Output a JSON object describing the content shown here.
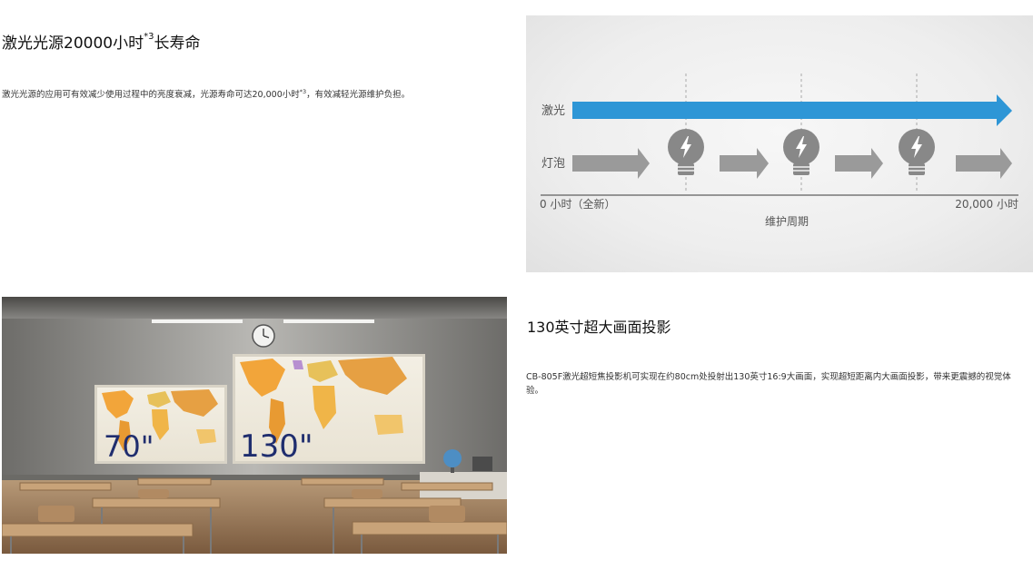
{
  "laser_section": {
    "heading_main": "激光光源20000小时",
    "heading_sup": "*3",
    "heading_tail": "长寿命",
    "desc_main": "激光光源的应用可有效减少使用过程中的亮度衰减，光源寿命可达20,000小时",
    "desc_sup": "*3",
    "desc_tail": "，有效减轻光源维护负担。"
  },
  "timeline_diagram": {
    "row_laser_label": "激光",
    "row_bulb_label": "灯泡",
    "start_label": "0 小时（全新）",
    "end_label": "20,000 小时",
    "axis_caption": "维护周期",
    "colors": {
      "laser_arrow": "#2e96d6",
      "bulb_arrow": "#9a9a9a",
      "bulb_icon": "#888888"
    },
    "icons": [
      "lightbulb-icon",
      "lightbulb-icon",
      "lightbulb-icon"
    ]
  },
  "classroom_image": {
    "small_screen_label": "70\"",
    "large_screen_label": "130\""
  },
  "projection_section": {
    "heading": "130英寸超大画面投影",
    "desc": "CB-805F激光超短焦投影机可实现在约80cm处投射出130英寸16:9大画面，实现超短距离内大画面投影，带来更震撼的视觉体验。"
  }
}
